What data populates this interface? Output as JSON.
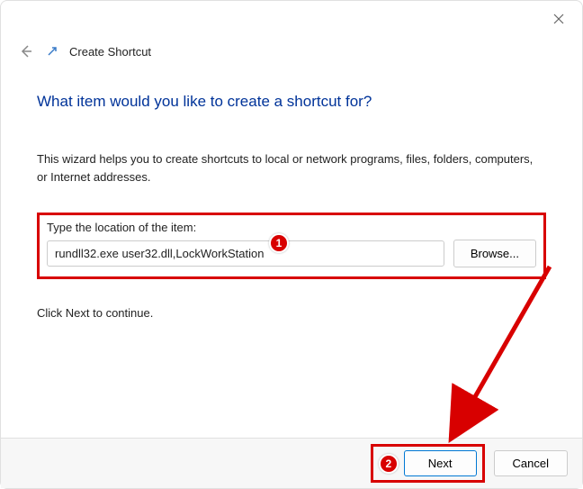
{
  "window": {
    "title": "Create Shortcut"
  },
  "content": {
    "heading": "What item would you like to create a shortcut for?",
    "description": "This wizard helps you to create shortcuts to local or network programs, files, folders, computers, or Internet addresses.",
    "input_label": "Type the location of the item:",
    "input_value": "rundll32.exe user32.dll,LockWorkStation",
    "browse_label": "Browse...",
    "continue_text": "Click Next to continue."
  },
  "footer": {
    "next_label": "Next",
    "cancel_label": "Cancel"
  },
  "annotations": {
    "badge1": "1",
    "badge2": "2"
  }
}
